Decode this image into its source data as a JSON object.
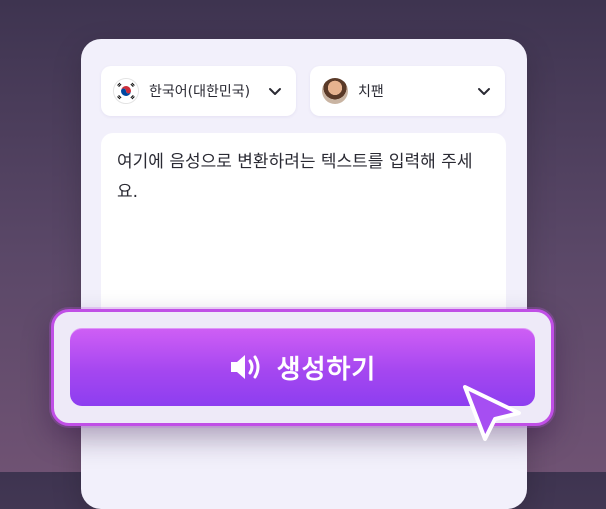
{
  "language_select": {
    "label": "한국어(대한민국)",
    "flag_icon": "korea-flag-icon"
  },
  "voice_select": {
    "label": "치팬",
    "avatar_icon": "voice-avatar-icon"
  },
  "editor": {
    "placeholder": "여기에 음성으로 변환하려는 텍스트를 입력해 주세요."
  },
  "generate_button": {
    "label": "생성하기",
    "icon": "speaker-icon"
  },
  "colors": {
    "background": "#4b3d5c",
    "card": "#f2f0fb",
    "button_start": "#cf5ff5",
    "button_end": "#8d3ef0",
    "cursor": "#a64ef2"
  }
}
